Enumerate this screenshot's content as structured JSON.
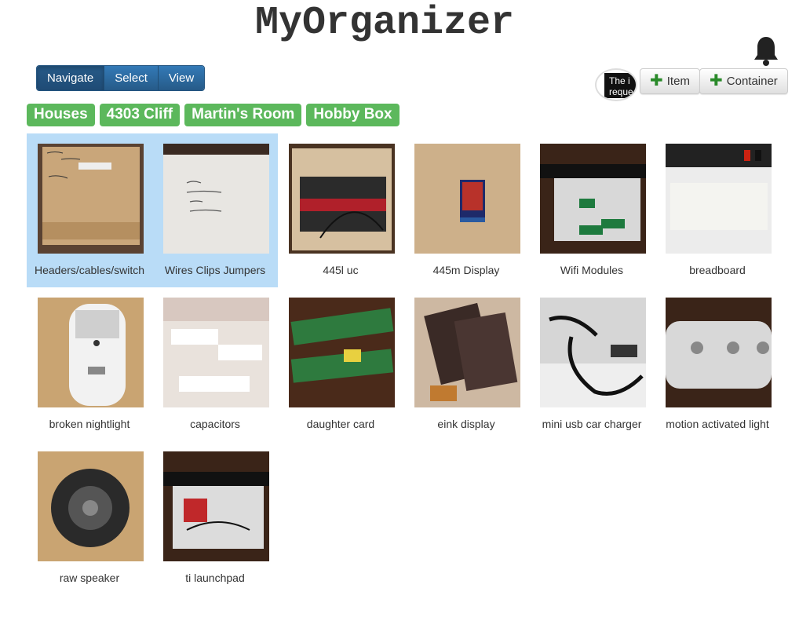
{
  "app": {
    "title": "MyOrganizer"
  },
  "header": {
    "bell_icon": "bell-icon",
    "modes": [
      {
        "label": "Navigate",
        "active": true
      },
      {
        "label": "Select",
        "active": false
      },
      {
        "label": "View",
        "active": false
      }
    ],
    "status_tooltip": "The i\nreque",
    "add_item_label": "Item",
    "add_container_label": "Container",
    "add_icon": "plus-icon",
    "accent_green": "#5cb85c",
    "accent_blue": "#337ab7"
  },
  "breadcrumb": [
    "Houses",
    "4303 Cliff",
    "Martin's Room",
    "Hobby Box"
  ],
  "items": [
    {
      "label": "Headers/cables/switch",
      "selected": true
    },
    {
      "label": "Wires Clips Jumpers",
      "selected": true
    },
    {
      "label": "445l uc",
      "selected": false
    },
    {
      "label": "445m Display",
      "selected": false
    },
    {
      "label": "Wifi Modules",
      "selected": false
    },
    {
      "label": "breadboard",
      "selected": false
    },
    {
      "label": "broken nightlight",
      "selected": false
    },
    {
      "label": "capacitors",
      "selected": false
    },
    {
      "label": "daughter card",
      "selected": false
    },
    {
      "label": "eink display",
      "selected": false
    },
    {
      "label": "mini usb car charger",
      "selected": false
    },
    {
      "label": "motion activated light",
      "selected": false
    },
    {
      "label": "raw speaker",
      "selected": false
    },
    {
      "label": "ti launchpad",
      "selected": false
    }
  ]
}
